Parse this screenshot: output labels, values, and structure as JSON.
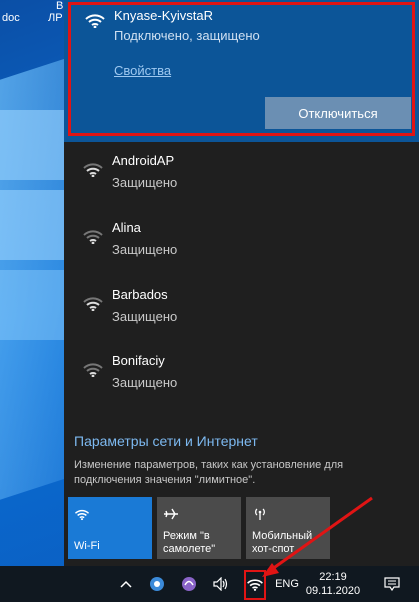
{
  "desktop": {
    "labels": [
      "doc",
      "В",
      "ЛР"
    ]
  },
  "connected_network": {
    "name": "Knyase-KyivstaR",
    "status": "Подключено, защищено",
    "properties_link": "Свойства",
    "disconnect_label": "Отключиться"
  },
  "networks": [
    {
      "name": "AndroidAP",
      "status": "Защищено"
    },
    {
      "name": "Alina",
      "status": "Защищено"
    },
    {
      "name": "Barbados",
      "status": "Защищено"
    },
    {
      "name": "Bonifaciy",
      "status": "Защищено"
    }
  ],
  "settings": {
    "title": "Параметры сети и Интернет",
    "description": "Изменение параметров, таких как установление для подключения значения \"лимитное\"."
  },
  "quick_actions": [
    {
      "label": "Wi-Fi",
      "icon": "wifi-icon",
      "active": true
    },
    {
      "label": "Режим \"в самолете\"",
      "icon": "airplane-icon",
      "active": false
    },
    {
      "label": "Мобильный хот-спот",
      "icon": "hotspot-icon",
      "active": false
    }
  ],
  "taskbar": {
    "language": "ENG",
    "time": "22:19",
    "date": "09.11.2020"
  },
  "colors": {
    "accent": "#1a7ad6",
    "connected_bg": "#0c5598",
    "highlight": "#e01414"
  }
}
